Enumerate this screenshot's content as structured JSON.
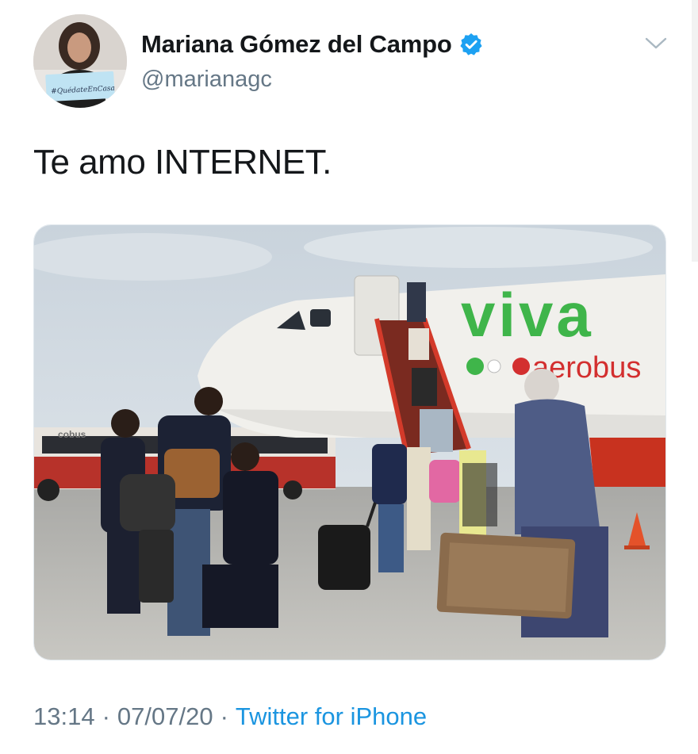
{
  "tweet": {
    "author": {
      "display_name": "Mariana Gómez del Campo",
      "handle": "@marianagc",
      "verified": true,
      "avatar_sign_text": "#QuédateEnCasa"
    },
    "text": "Te amo INTERNET.",
    "media": {
      "airline_logo_main": "viva",
      "airline_logo_sub": "aerobus",
      "bus_text": "cobus"
    },
    "time": "13:14",
    "date": "07/07/20",
    "separator": "·",
    "source": "Twitter for iPhone"
  },
  "colors": {
    "verified_badge": "#1da1f2",
    "link": "#1b95e0",
    "secondary_text": "#657786",
    "viva_green": "#3fb54a"
  },
  "icons": {
    "verified": "verified-badge-icon",
    "menu": "chevron-down-icon"
  }
}
